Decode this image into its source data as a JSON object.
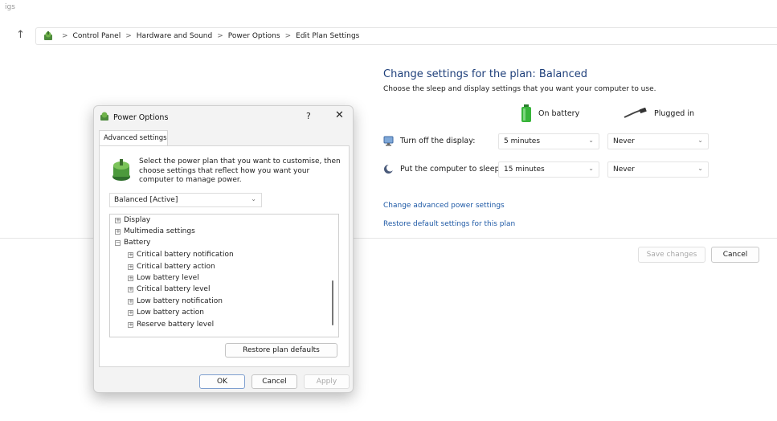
{
  "window": {
    "title_fragment": "igs"
  },
  "breadcrumb": {
    "items": [
      "Control Panel",
      "Hardware and Sound",
      "Power Options",
      "Edit Plan Settings"
    ],
    "separator": ">"
  },
  "main": {
    "heading": "Change settings for the plan: Balanced",
    "subtext": "Choose the sleep and display settings that you want your computer to use.",
    "on_battery_label": "On battery",
    "plugged_in_label": "Plugged in",
    "display_label": "Turn off the display:",
    "display_battery": "5 minutes",
    "display_plugged": "Never",
    "sleep_label": "Put the computer to sleep:",
    "sleep_battery": "15 minutes",
    "sleep_plugged": "Never",
    "advanced_link": "Change advanced power settings",
    "restore_link": "Restore default settings for this plan",
    "save_label": "Save changes",
    "cancel_label": "Cancel"
  },
  "dialog": {
    "title": "Power Options",
    "help": "?",
    "close": "✕",
    "tab": "Advanced settings",
    "description": "Select the power plan that you want to customise, then choose settings that reflect how you want your computer to manage power.",
    "plan": "Balanced [Active]",
    "tree": {
      "display": "Display",
      "multimedia": "Multimedia settings",
      "battery": "Battery",
      "critical_notification": "Critical battery notification",
      "critical_action": "Critical battery action",
      "low_level": "Low battery level",
      "critical_level": "Critical battery level",
      "low_notification": "Low battery notification",
      "low_action": "Low battery action",
      "reserve_level": "Reserve battery level"
    },
    "restore_defaults": "Restore plan defaults",
    "ok": "OK",
    "cancel": "Cancel",
    "apply": "Apply"
  },
  "colors": {
    "heading": "#1e3f7a",
    "link": "#1f5aa6",
    "battery": "#38b43a"
  },
  "icons": {
    "back": "up-arrow-icon",
    "control_panel": "control-panel-icon",
    "battery": "battery-icon",
    "plug": "plug-icon"
  }
}
